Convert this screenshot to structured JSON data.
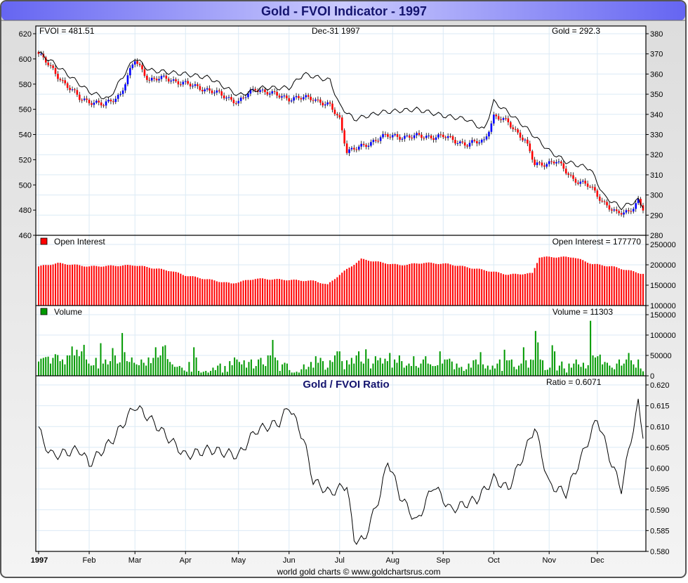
{
  "title": "Gold - FVOI Indicator - 1997",
  "footer": "world gold charts © www.goldchartsrus.com",
  "colors": {
    "title_text": "#14146e",
    "up": "#0000ff",
    "down": "#ff0000",
    "oi": "#ff0000",
    "volume": "#009900",
    "line": "#000000",
    "grid": "#dbeaf5"
  },
  "chart_data": {
    "type": "line",
    "x_labels": [
      "1997",
      "Feb",
      "Mar",
      "Apr",
      "May",
      "Jun",
      "Jul",
      "Aug",
      "Sep",
      "Oct",
      "Nov",
      "Dec"
    ],
    "month_start_day": [
      0,
      21,
      40,
      61,
      83,
      104,
      125,
      147,
      168,
      189,
      212,
      232
    ],
    "trading_days": 252,
    "price_panel": {
      "header_left": "FVOI = 481.51",
      "header_center": "Dec-31  1997",
      "header_right": "Gold = 292.3",
      "left_axis": {
        "label": "FVOI",
        "ylim": [
          460,
          620
        ],
        "ticks": [
          "460",
          "480",
          "500",
          "520",
          "540",
          "560",
          "580",
          "600",
          "620"
        ]
      },
      "right_axis": {
        "label": "Gold",
        "ylim": [
          280,
          380
        ],
        "ticks": [
          "280",
          "290",
          "300",
          "310",
          "320",
          "330",
          "340",
          "350",
          "360",
          "370",
          "380"
        ]
      },
      "gold_close_keypoints": [
        [
          0,
          370
        ],
        [
          6,
          362
        ],
        [
          11,
          355
        ],
        [
          17,
          348
        ],
        [
          27,
          344.5
        ],
        [
          34,
          350
        ],
        [
          40,
          367
        ],
        [
          46,
          357
        ],
        [
          53,
          358
        ],
        [
          61,
          355
        ],
        [
          68,
          353
        ],
        [
          75,
          350
        ],
        [
          83,
          346
        ],
        [
          90,
          353
        ],
        [
          97,
          350
        ],
        [
          104,
          348
        ],
        [
          114,
          348
        ],
        [
          121,
          344
        ],
        [
          125,
          337.5
        ],
        [
          128,
          322
        ],
        [
          135,
          324
        ],
        [
          142,
          329
        ],
        [
          150,
          329
        ],
        [
          157,
          329
        ],
        [
          168,
          329
        ],
        [
          178,
          325
        ],
        [
          185,
          327
        ],
        [
          189,
          339
        ],
        [
          195,
          336
        ],
        [
          202,
          327
        ],
        [
          206,
          315
        ],
        [
          215,
          316.6
        ],
        [
          222,
          308
        ],
        [
          229,
          304
        ],
        [
          235,
          296
        ],
        [
          240,
          290.5
        ],
        [
          245,
          292
        ],
        [
          249,
          297
        ],
        [
          251,
          292.3
        ]
      ],
      "fvoi_keypoints": [
        [
          0,
          605
        ],
        [
          6,
          597
        ],
        [
          21,
          574
        ],
        [
          29,
          568
        ],
        [
          40,
          601
        ],
        [
          46,
          591
        ],
        [
          61,
          588
        ],
        [
          71,
          585
        ],
        [
          83,
          571
        ],
        [
          93,
          577
        ],
        [
          104,
          577
        ],
        [
          110,
          588
        ],
        [
          121,
          583
        ],
        [
          125,
          563
        ],
        [
          131,
          552
        ],
        [
          142,
          557.6
        ],
        [
          157,
          560
        ],
        [
          168,
          555
        ],
        [
          178,
          552
        ],
        [
          185,
          543.6
        ],
        [
          189,
          566
        ],
        [
          195,
          557.6
        ],
        [
          202,
          546
        ],
        [
          212,
          527
        ],
        [
          219,
          518.5
        ],
        [
          229,
          513
        ],
        [
          235,
          490.7
        ],
        [
          242,
          482
        ],
        [
          249,
          488
        ],
        [
          251,
          481.51
        ]
      ]
    },
    "oi_panel": {
      "legend": "Open Interest",
      "header_right": "Open Interest = 177770",
      "ylim": [
        100000,
        250000
      ],
      "ticks": [
        "100000",
        "150000",
        "200000",
        "250000"
      ],
      "keypoints": [
        [
          0,
          196000
        ],
        [
          8,
          204000
        ],
        [
          21,
          196000
        ],
        [
          40,
          199000
        ],
        [
          55,
          185000
        ],
        [
          61,
          174000
        ],
        [
          80,
          154000
        ],
        [
          90,
          166000
        ],
        [
          104,
          163000
        ],
        [
          115,
          160000
        ],
        [
          120,
          151000
        ],
        [
          125,
          176000
        ],
        [
          134,
          214000
        ],
        [
          142,
          206000
        ],
        [
          150,
          199000
        ],
        [
          160,
          205000
        ],
        [
          170,
          202000
        ],
        [
          186,
          186000
        ],
        [
          195,
          176000
        ],
        [
          205,
          179000
        ],
        [
          208,
          219000
        ],
        [
          222,
          219000
        ],
        [
          230,
          202000
        ],
        [
          238,
          196000
        ],
        [
          251,
          177770
        ]
      ]
    },
    "volume_panel": {
      "legend": "Volume",
      "header_right": "Volume = 11303",
      "ylim": [
        0,
        150000
      ],
      "ticks": [
        "0",
        "50000",
        "100000",
        "150000"
      ],
      "values_thousands": [
        35,
        42,
        44,
        46,
        47,
        30,
        44,
        53,
        51,
        36,
        40,
        28,
        50,
        50,
        72,
        50,
        64,
        48,
        60,
        76,
        40,
        30,
        25,
        26,
        44,
        18,
        80,
        30,
        40,
        28,
        36,
        68,
        50,
        30,
        33,
        105,
        58,
        36,
        34,
        45,
        32,
        28,
        26,
        40,
        32,
        25,
        45,
        31,
        44,
        70,
        45,
        50,
        72,
        75,
        41,
        34,
        28,
        22,
        22,
        24,
        20,
        13,
        10,
        34,
        10,
        70,
        45,
        12,
        8,
        10,
        12,
        8,
        12,
        20,
        14,
        25,
        30,
        8,
        24,
        10,
        36,
        26,
        45,
        40,
        34,
        28,
        38,
        20,
        34,
        40,
        18,
        24,
        40,
        44,
        28,
        24,
        50,
        50,
        88,
        45,
        38,
        12,
        28,
        32,
        30,
        14,
        8,
        8,
        10,
        8,
        16,
        28,
        16,
        22,
        34,
        20,
        48,
        32,
        44,
        36,
        15,
        20,
        38,
        34,
        50,
        60,
        60,
        36,
        16,
        38,
        28,
        44,
        30,
        50,
        60,
        35,
        30,
        65,
        42,
        18,
        30,
        48,
        38,
        44,
        30,
        42,
        36,
        56,
        20,
        40,
        32,
        50,
        36,
        20,
        25,
        30,
        24,
        48,
        24,
        20,
        30,
        40,
        48,
        30,
        28,
        24,
        24,
        26,
        60,
        30,
        40,
        40,
        42,
        35,
        16,
        30,
        20,
        22,
        12,
        16,
        30,
        20,
        38,
        40,
        28,
        58,
        28,
        18,
        25,
        15,
        25,
        18,
        30,
        40,
        12,
        64,
        38,
        38,
        40,
        22,
        16,
        25,
        30,
        70,
        38,
        20,
        40,
        39,
        110,
        82,
        40,
        38,
        14,
        15,
        20,
        75,
        60,
        13,
        25,
        35,
        18,
        8,
        30,
        20,
        30,
        40,
        28,
        22,
        32,
        18,
        26,
        135,
        50,
        45,
        48,
        52,
        28,
        34,
        32,
        25,
        20,
        16,
        30,
        40,
        25,
        30,
        40,
        56,
        38,
        28,
        20,
        40,
        18,
        11
      ]
    },
    "ratio_panel": {
      "title": "Gold / FVOI Ratio",
      "header_right": "Ratio = 0.6071",
      "ylim": [
        0.58,
        0.62
      ],
      "ticks": [
        "0.580",
        "0.585",
        "0.590",
        "0.595",
        "0.600",
        "0.605",
        "0.610",
        "0.615",
        "0.620"
      ],
      "keypoints": [
        [
          0,
          0.61
        ],
        [
          2,
          0.606
        ],
        [
          6,
          0.603
        ],
        [
          17,
          0.6045
        ],
        [
          21,
          0.601
        ],
        [
          31,
          0.607
        ],
        [
          40,
          0.615
        ],
        [
          46,
          0.612
        ],
        [
          61,
          0.603
        ],
        [
          71,
          0.6045
        ],
        [
          83,
          0.603
        ],
        [
          90,
          0.609
        ],
        [
          100,
          0.611
        ],
        [
          104,
          0.615
        ],
        [
          110,
          0.607
        ],
        [
          114,
          0.597
        ],
        [
          121,
          0.594
        ],
        [
          128,
          0.596
        ],
        [
          131,
          0.583
        ],
        [
          135,
          0.5825
        ],
        [
          142,
          0.594
        ],
        [
          145,
          0.602
        ],
        [
          150,
          0.5935
        ],
        [
          157,
          0.587
        ],
        [
          164,
          0.596
        ],
        [
          171,
          0.59
        ],
        [
          182,
          0.5925
        ],
        [
          189,
          0.5975
        ],
        [
          195,
          0.595
        ],
        [
          202,
          0.604
        ],
        [
          206,
          0.61
        ],
        [
          212,
          0.596
        ],
        [
          219,
          0.594
        ],
        [
          226,
          0.6035
        ],
        [
          232,
          0.612
        ],
        [
          238,
          0.601
        ],
        [
          242,
          0.595
        ],
        [
          246,
          0.607
        ],
        [
          249,
          0.6155
        ],
        [
          251,
          0.6071
        ]
      ]
    }
  }
}
